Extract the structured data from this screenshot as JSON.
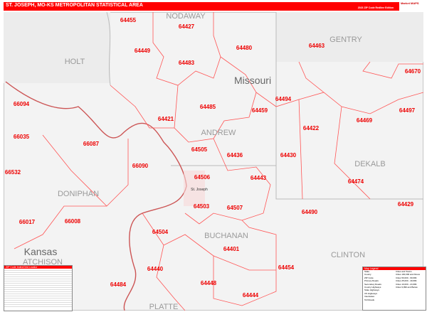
{
  "header": {
    "title": "ST. JOSEPH, MO-KS METROPOLITAN STATISTICAL AREA",
    "edition": "2023 ZIP Code Redline Edition",
    "logo": "Market MAPS"
  },
  "states": [
    "Missouri",
    "Kansas"
  ],
  "counties": [
    "NODAWAY",
    "GENTRY",
    "HOLT",
    "ANDREW",
    "DEKALB",
    "DONIPHAN",
    "BUCHANAN",
    "CLINTON",
    "ATCHISON",
    "PLATTE"
  ],
  "zips": [
    "64455",
    "64427",
    "64449",
    "64480",
    "64463",
    "64483",
    "64670",
    "64494",
    "64485",
    "64459",
    "64497",
    "66094",
    "64421",
    "64422",
    "64469",
    "66035",
    "64505",
    "64436",
    "64430",
    "66087",
    "66090",
    "66532",
    "64506",
    "64474",
    "64443",
    "64503",
    "64507",
    "64490",
    "64429",
    "66017",
    "66008",
    "64504",
    "64401",
    "64454",
    "64440",
    "64484",
    "64448",
    "64444"
  ],
  "city": "St. Joseph",
  "index": {
    "title": "ZIP Code Index/Grid Locator"
  },
  "legend": {
    "title": "Map Legend",
    "items": [
      "State",
      "County",
      "ZIP Code",
      "Primary Roads",
      "Secondary Roads",
      "County Highways",
      "State Highways",
      "US Highways",
      "Interstates",
      "Toll Roads"
    ],
    "pop_title": "Cities and Towns",
    "pop": [
      "Cities 100,000 and Above",
      "Cities 50,000 - 99,999",
      "Cities 25,000 - 49,999",
      "Cities 10,000 - 24,999",
      "Cities 9,999 and Below"
    ]
  }
}
